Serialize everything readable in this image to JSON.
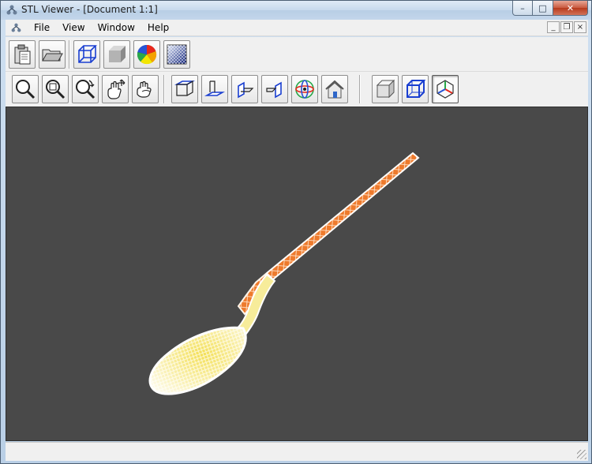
{
  "window": {
    "title": "STL Viewer - [Document 1:1]",
    "min_glyph": "–",
    "max_glyph": "□",
    "close_glyph": "✕"
  },
  "menu": {
    "items": [
      {
        "id": "file",
        "label": "File"
      },
      {
        "id": "view",
        "label": "View"
      },
      {
        "id": "window",
        "label": "Window"
      },
      {
        "id": "help",
        "label": "Help"
      }
    ],
    "mdi_min": "_",
    "mdi_restore": "❐",
    "mdi_close": "×"
  },
  "toolbar1": {
    "buttons": [
      {
        "name": "paste-button",
        "icon": "clipboard-icon"
      },
      {
        "name": "open-button",
        "icon": "folder-open-icon"
      },
      {
        "name": "wireframe-cube-button",
        "icon": "wire-cube-icon"
      },
      {
        "name": "solid-cube-button",
        "icon": "solid-cube-icon"
      },
      {
        "name": "color-button",
        "icon": "color-wheel-icon"
      },
      {
        "name": "background-button",
        "icon": "background-gradient-icon"
      }
    ]
  },
  "toolbar2": {
    "buttons": [
      {
        "name": "zoom-button",
        "icon": "magnifier-icon"
      },
      {
        "name": "zoom-window-button",
        "icon": "zoom-window-icon"
      },
      {
        "name": "zoom-dynamic-button",
        "icon": "zoom-rotate-icon"
      },
      {
        "name": "pan-button",
        "icon": "pan-hand-icon"
      },
      {
        "name": "rotate-hand-button",
        "icon": "rotate-hand-icon"
      },
      {
        "name": "view-top-button",
        "icon": "view-top-icon"
      },
      {
        "name": "view-bottom-button",
        "icon": "view-bottom-icon"
      },
      {
        "name": "view-left-button",
        "icon": "view-left-icon"
      },
      {
        "name": "view-right-button",
        "icon": "view-right-icon"
      },
      {
        "name": "view-axo-button",
        "icon": "axo-sphere-icon"
      },
      {
        "name": "view-home-button",
        "icon": "home-icon"
      },
      {
        "name": "shaded-mode-button",
        "icon": "shaded-box-icon"
      },
      {
        "name": "wireframe-mode-button",
        "icon": "wire-box-icon"
      },
      {
        "name": "axes-triad-button",
        "icon": "axes-triad-icon",
        "active": true
      }
    ]
  },
  "viewport": {
    "background": "#494949",
    "model_colors": {
      "bowl": "#f5e35a",
      "handle": "#f07a2a",
      "mesh": "#ffffff"
    }
  },
  "status": {
    "text": ""
  }
}
